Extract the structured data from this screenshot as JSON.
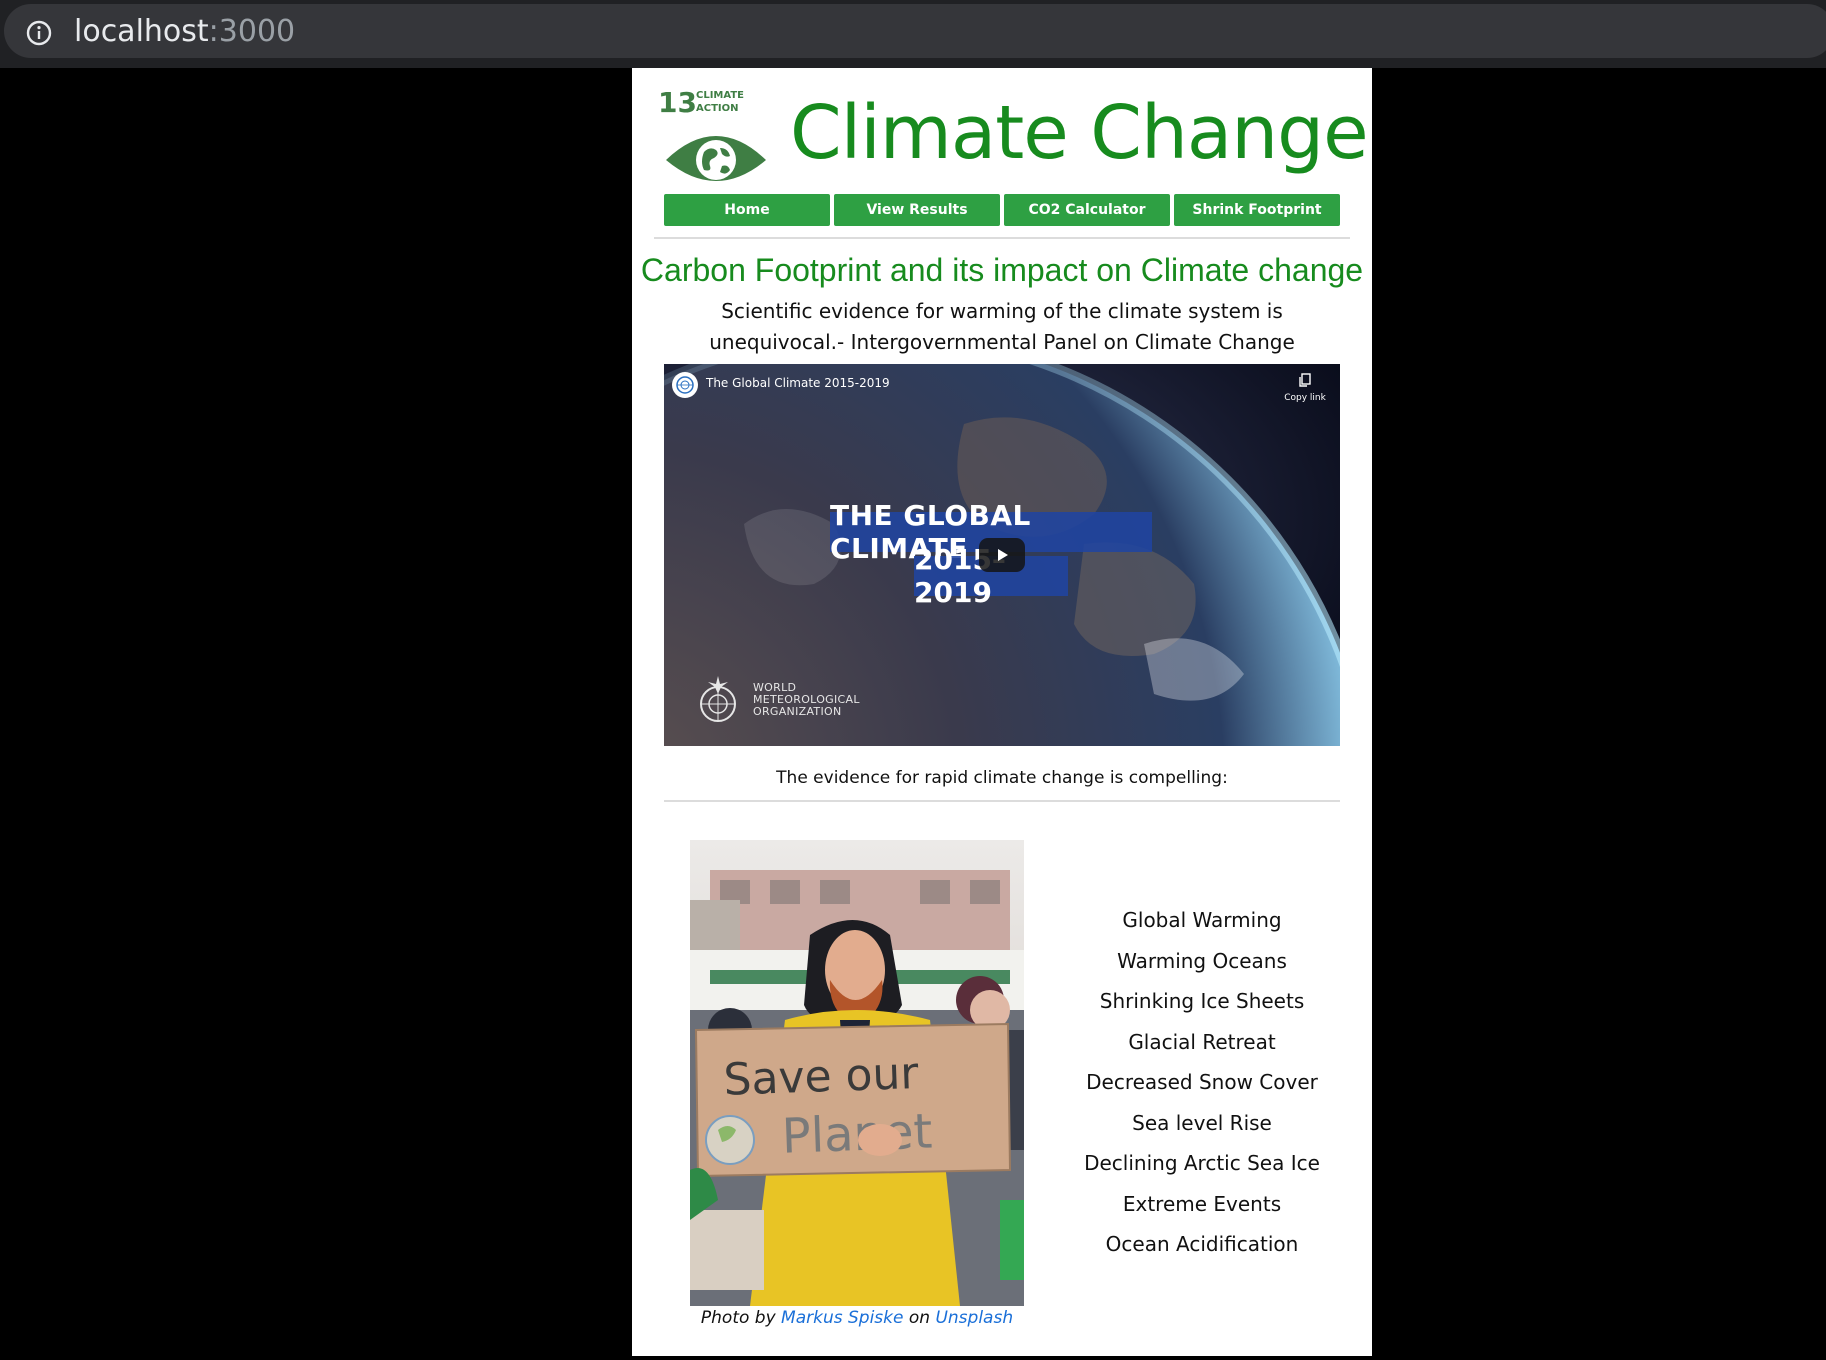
{
  "browser": {
    "url_host": "localhost",
    "url_port": ":3000"
  },
  "header": {
    "sdg_number": "13",
    "sdg_label_line1": "CLIMATE",
    "sdg_label_line2": "ACTION",
    "title": "Climate Change"
  },
  "nav": {
    "items": [
      {
        "label": "Home"
      },
      {
        "label": "View Results"
      },
      {
        "label": "CO2 Calculator"
      },
      {
        "label": "Shrink Footprint"
      }
    ]
  },
  "main": {
    "headline": "Carbon Footprint and its impact on Climate change",
    "quote": "Scientific evidence for warming of the climate system is unequivocal.- Intergovernmental Panel on Climate Change",
    "video": {
      "title": "The Global Climate 2015-2019",
      "copy_link_label": "Copy link",
      "banner_line1": "THE GLOBAL CLIMATE",
      "banner_line2": "2015–2019",
      "org_text": "WORLD\nMETEOROLOGICAL\nORGANIZATION"
    },
    "evidence_intro": "The evidence for rapid climate change is compelling:",
    "photo": {
      "sign_line1": "Save our",
      "sign_line2": "Planet",
      "caption_prefix": "Photo by",
      "photographer": "Markus Spiske",
      "caption_mid": "on",
      "source": "Unsplash"
    },
    "evidence_items": [
      "Global Warming",
      "Warming Oceans",
      "Shrinking Ice Sheets",
      "Glacial Retreat",
      "Decreased Snow Cover",
      "Sea level Rise",
      "Declining Arctic Sea Ice",
      "Extreme Events",
      "Ocean Acidification"
    ]
  },
  "colors": {
    "brand_green": "#178b1e",
    "nav_green": "#2ea043",
    "link_blue": "#1a6fd8"
  }
}
